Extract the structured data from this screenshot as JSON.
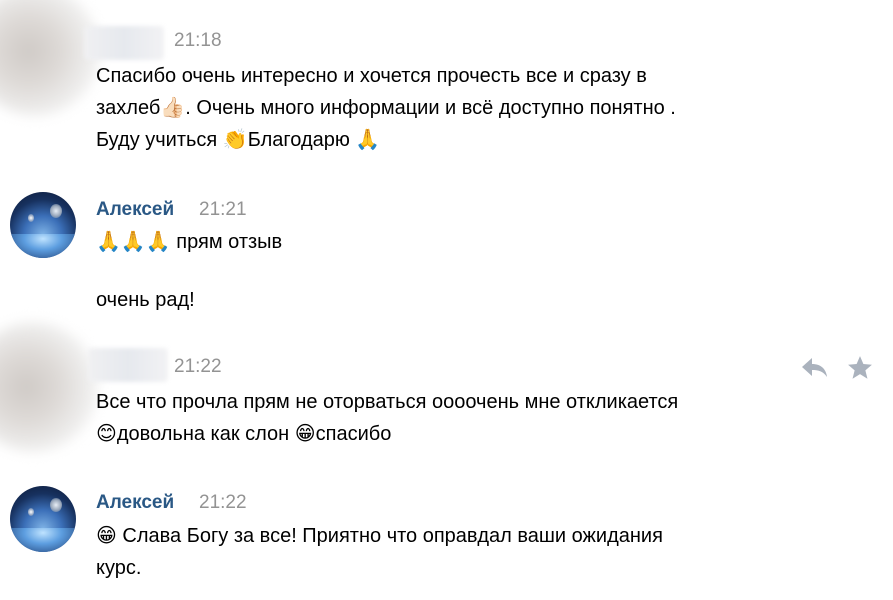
{
  "messages": [
    {
      "time": "21:18",
      "lines": [
        "Спасибо очень интересно и хочется прочесть все и сразу в",
        "захлеб👍🏻. Очень много информации и всё доступно понятно .",
        "Буду учиться 👏Благодарю 🙏"
      ]
    },
    {
      "author": "Алексей",
      "time": "21:21",
      "lines": [
        "🙏🙏🙏 прям отзыв"
      ],
      "extra_line": "очень рад!"
    },
    {
      "time": "21:22",
      "lines": [
        "Все что прочла прям не оторваться оооочень мне откликается",
        "😊довольна как слон 😁спасибо"
      ]
    },
    {
      "author": "Алексей",
      "time": "21:22",
      "lines": [
        "😁 Слава Богу за все! Приятно что оправдал ваши ожидания",
        "курс."
      ]
    }
  ],
  "actions": {
    "reply_icon": "reply-icon",
    "favorite_icon": "star-icon"
  },
  "colors": {
    "author": "#2a5885",
    "time": "#939393",
    "icon": "#aab2bd"
  }
}
